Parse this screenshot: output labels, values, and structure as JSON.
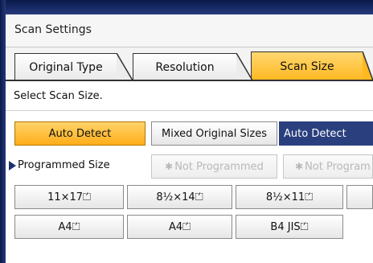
{
  "header": {
    "title": "Scan Settings"
  },
  "tabs": [
    {
      "label": "Original Type",
      "active": false
    },
    {
      "label": "Resolution",
      "active": false
    },
    {
      "label": "Scan Size",
      "active": true
    }
  ],
  "instruction": "Select Scan Size.",
  "auto_detect": {
    "label": "Auto Detect",
    "selected": true
  },
  "mixed_sizes": {
    "label": "Mixed Original Sizes"
  },
  "current_value": "Auto Detect",
  "programmed": {
    "label": "Programmed Size",
    "slots": [
      {
        "label": "Not Programmed",
        "star": "✱"
      },
      {
        "label": "Not Program",
        "star": "✱"
      }
    ]
  },
  "sizes_row1": [
    "11×17⏍",
    "8½×14⏍",
    "8½×11⏍"
  ],
  "sizes_row2": [
    "A4⏍",
    "A4⏍",
    "B4 JIS⏍"
  ],
  "colors": {
    "accent": "#ffb820",
    "readout": "#2a3f7e",
    "frame": "#1d2f6e"
  }
}
